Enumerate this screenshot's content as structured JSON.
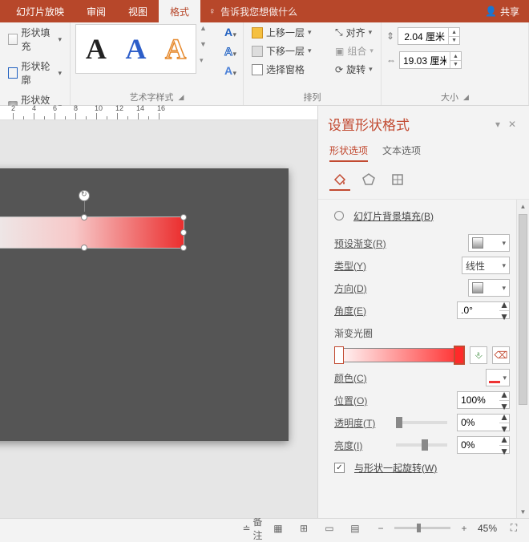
{
  "tabs": {
    "items": [
      "幻灯片放映",
      "审阅",
      "视图",
      "格式"
    ],
    "active": 3
  },
  "tellme": "告诉我您想做什么",
  "share": "共享",
  "ribbon": {
    "shape_fill": "形状填充",
    "shape_outline": "形状轮廓",
    "shape_effects": "形状效果",
    "wordart_label": "艺术字样式",
    "bring_forward": "上移一层",
    "send_backward": "下移一层",
    "selection_pane": "选择窗格",
    "align": "对齐",
    "group_btn": "组合",
    "rotate": "旋转",
    "arrange_label": "排列",
    "height": "2.04 厘米",
    "width": "19.03 厘米",
    "size_label": "大小"
  },
  "ruler_marks": [
    "2",
    "",
    "4",
    "",
    "6",
    "",
    "8",
    "",
    "10",
    "",
    "12",
    "",
    "14",
    "",
    "16"
  ],
  "pane": {
    "title": "设置形状格式",
    "tab_shape": "形状选项",
    "tab_text": "文本选项",
    "slide_bg_fill": "幻灯片背景填充(B)",
    "preset": "预设渐变(R)",
    "type_lbl": "类型(Y)",
    "type_val": "线性",
    "direction": "方向(D)",
    "angle_lbl": "角度(E)",
    "angle_val": ".0°",
    "stops_lbl": "渐变光圈",
    "color_lbl": "颜色(C)",
    "position_lbl": "位置(O)",
    "position_val": "100%",
    "transparency_lbl": "透明度(T)",
    "transparency_val": "0%",
    "brightness_lbl": "亮度(I)",
    "brightness_val": "0%",
    "rotate_with_shape": "与形状一起旋转(W)"
  },
  "status": {
    "notes": "备注",
    "zoom": "45%"
  }
}
